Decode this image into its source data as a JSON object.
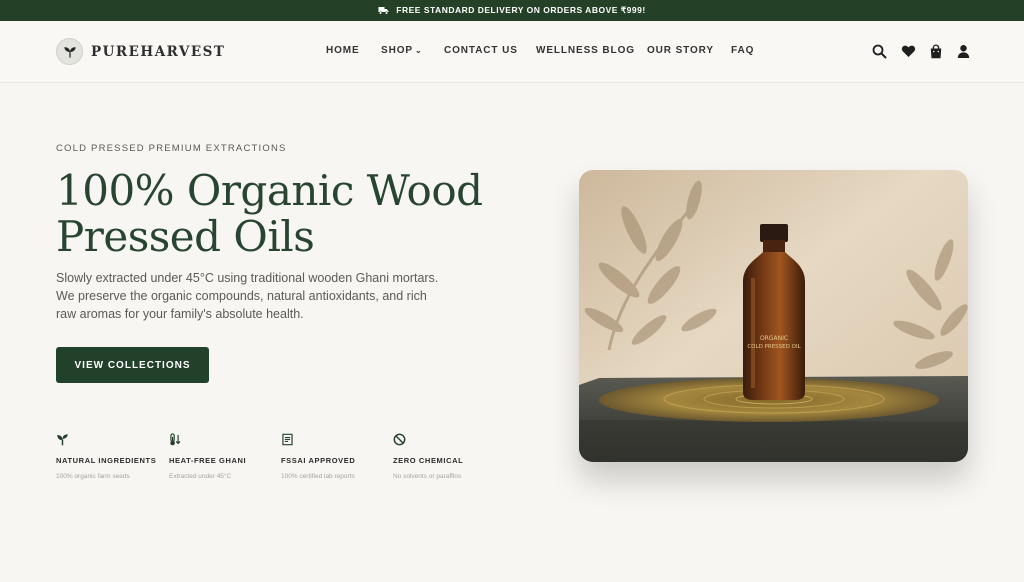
{
  "topbar": {
    "icon": "truck-icon",
    "text": "FREE STANDARD DELIVERY ON ORDERS ABOVE ₹999!"
  },
  "brand": {
    "name": "PUREHARVEST",
    "logo_icon": "leaf-icon"
  },
  "nav": {
    "home": "HOME",
    "shop": "SHOP",
    "shop_chevron": "⌄",
    "contact": "CONTACT US",
    "blog": "WELLNESS BLOG",
    "story": "OUR STORY",
    "faq": "FAQ"
  },
  "header_icons": [
    "search-icon",
    "heart-icon",
    "shopping-bag-icon",
    "user-icon"
  ],
  "hero": {
    "eyebrow": "COLD PRESSED PREMIUM EXTRACTIONS",
    "title_line1": "100% Organic Wood",
    "title_line2": "Pressed Oils",
    "description": "Slowly extracted under 45°C using traditional wooden Ghani mortars. We preserve the organic compounds, natural antioxidants, and rich raw aromas for your family's absolute health.",
    "cta": "VIEW COLLECTIONS",
    "bottle_label_line1": "ORGANIC",
    "bottle_label_line2": "COLD PRESSED OIL"
  },
  "features": [
    {
      "icon": "sprout-icon",
      "title": "NATURAL INGREDIENTS",
      "subtitle": "100% organic farm seeds"
    },
    {
      "icon": "thermometer-icon",
      "title": "HEAT-FREE GHANI",
      "subtitle": "Extracted under 45°C"
    },
    {
      "icon": "certificate-icon",
      "title": "FSSAI APPROVED",
      "subtitle": "100% certified lab reports"
    },
    {
      "icon": "ban-icon",
      "title": "ZERO CHEMICAL",
      "subtitle": "No solvents or paraffins"
    }
  ],
  "colors": {
    "brand_green": "#22412a",
    "title_green": "#274530",
    "background": "#f8f6f2"
  }
}
